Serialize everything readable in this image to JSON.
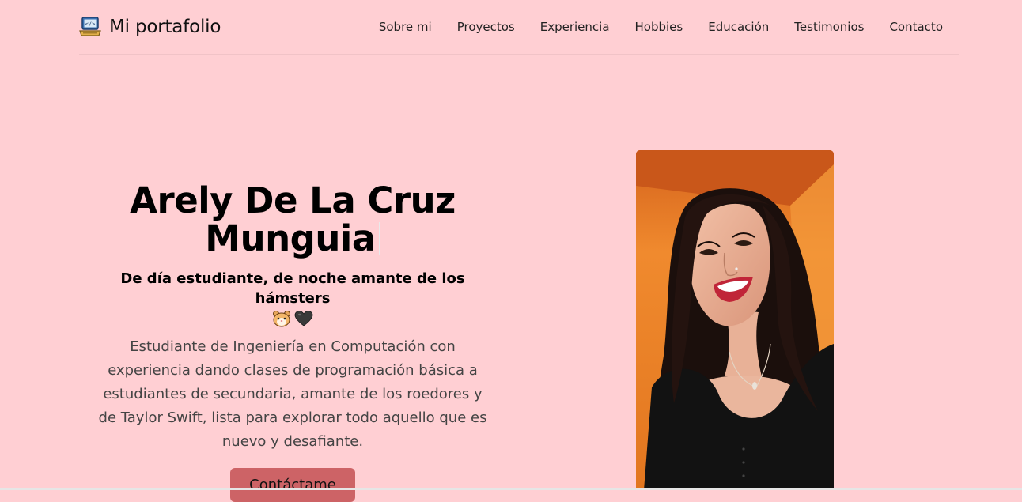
{
  "navbar": {
    "brand": {
      "icon": "laptop-code-icon",
      "label": "Mi portafolio"
    },
    "links": [
      {
        "label": "Sobre mi"
      },
      {
        "label": "Proyectos"
      },
      {
        "label": "Experiencia"
      },
      {
        "label": "Hobbies"
      },
      {
        "label": "Educación"
      },
      {
        "label": "Testimonios"
      },
      {
        "label": "Contacto"
      }
    ]
  },
  "hero": {
    "name_line1": "Arely De La Cruz",
    "name_line2": "Munguia",
    "tagline": "De día estudiante, de noche amante de los hámsters",
    "tagline_emojis": [
      "hamster-icon",
      "black-heart-icon"
    ],
    "description": "Estudiante de Ingeniería en Computación con experiencia dando clases de programación básica a estudiantes de secundaria, amante de los roedores y de Taylor Swift, lista para explorar todo aquello que es nuevo y desafiante.",
    "cta_label": "Contáctame",
    "photo": "profile-photo"
  },
  "colors": {
    "background": "#ffcfd3",
    "button": "#cd6366"
  }
}
